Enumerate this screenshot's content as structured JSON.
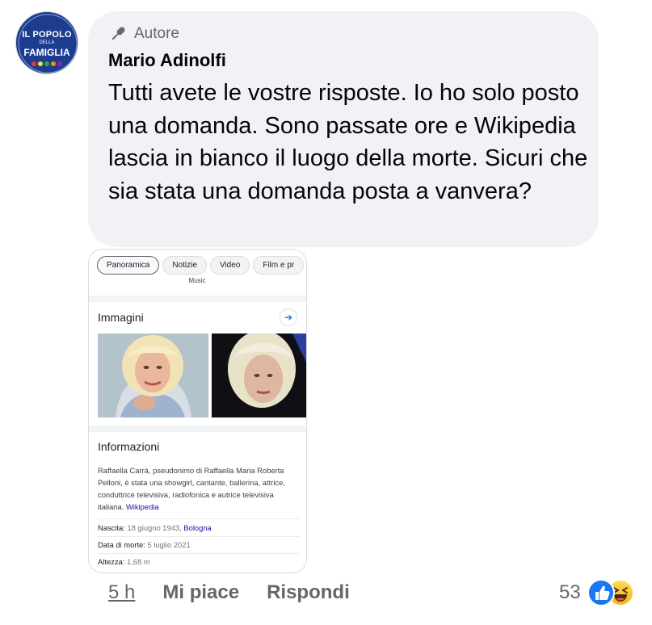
{
  "avatar": {
    "top_text": "IL POPOLO",
    "mid_text": "DELLA",
    "bottom_text": "FAMIGLIA",
    "brand_color": "#1c3d8f"
  },
  "comment": {
    "badge_icon": "microphone-icon",
    "badge_label": "Autore",
    "author": "Mario Adinolfi",
    "text": "Tutti avete le vostre risposte. Io ho solo posto una domanda. Sono passate ore e Wikipedia lascia in bianco il luogo della morte. Sicuri che sia stata una domanda posta a vanvera?",
    "bubble_color": "#f0f2f5"
  },
  "attachment": {
    "chips": [
      "Panoramica",
      "Notizie",
      "Video",
      "Film e pr"
    ],
    "music_label": "Music",
    "images_title": "Immagini",
    "info_title": "Informazioni",
    "info_body": "Raffaella Carrà, pseudonimo di Raffaella Maria Roberta Pelloni, è stata una showgirl, cantante, ballerina, attrice, conduttrice televisiva, radiofonica e autrice televisiva italiana.",
    "info_link": "Wikipedia",
    "facts": {
      "birth_label": "Nascita:",
      "birth_value": "18 giugno 1943,",
      "birth_place": "Bologna",
      "death_label": "Data di morte:",
      "death_value": "5 luglio 2021",
      "height_label": "Altezza:",
      "height_value": "1,68 m"
    }
  },
  "actions": {
    "time": "5 h",
    "like": "Mi piace",
    "reply": "Rispondi",
    "reaction_count": "53",
    "reactions": [
      "like-reaction-icon",
      "haha-reaction-icon"
    ],
    "like_color": "#1877f2"
  }
}
